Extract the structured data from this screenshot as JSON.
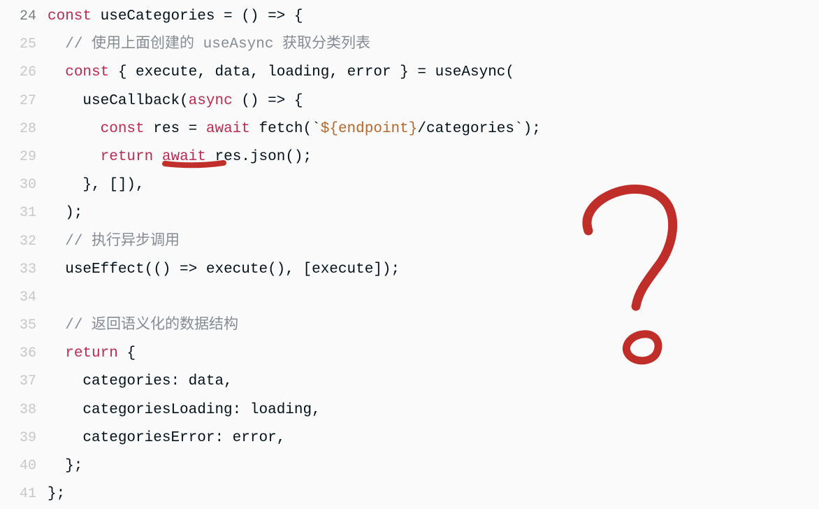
{
  "lines": [
    {
      "no": "24",
      "tokens": [
        [
          "kw",
          "const"
        ],
        [
          "pun",
          " "
        ],
        [
          "id",
          "useCategories"
        ],
        [
          "pun",
          " = () => {"
        ]
      ]
    },
    {
      "no": "25",
      "tokens": [
        [
          "pun",
          "  "
        ],
        [
          "cmt",
          "// 使用上面创建的 useAsync 获取分类列表"
        ]
      ]
    },
    {
      "no": "26",
      "tokens": [
        [
          "pun",
          "  "
        ],
        [
          "kw",
          "const"
        ],
        [
          "pun",
          " { "
        ],
        [
          "id",
          "execute"
        ],
        [
          "pun",
          ", "
        ],
        [
          "id",
          "data"
        ],
        [
          "pun",
          ", "
        ],
        [
          "id",
          "loading"
        ],
        [
          "pun",
          ", "
        ],
        [
          "id",
          "error"
        ],
        [
          "pun",
          " } = "
        ],
        [
          "fn",
          "useAsync"
        ],
        [
          "pun",
          "("
        ]
      ]
    },
    {
      "no": "27",
      "tokens": [
        [
          "pun",
          "    "
        ],
        [
          "fn",
          "useCallback"
        ],
        [
          "pun",
          "("
        ],
        [
          "kw",
          "async"
        ],
        [
          "pun",
          " () => {"
        ]
      ]
    },
    {
      "no": "28",
      "tokens": [
        [
          "pun",
          "      "
        ],
        [
          "kw",
          "const"
        ],
        [
          "pun",
          " "
        ],
        [
          "id",
          "res"
        ],
        [
          "pun",
          " = "
        ],
        [
          "kw",
          "await"
        ],
        [
          "pun",
          " "
        ],
        [
          "fn",
          "fetch"
        ],
        [
          "pun",
          "(`"
        ],
        [
          "inter",
          "${endpoint}"
        ],
        [
          "str",
          "/categories"
        ],
        [
          "pun",
          "`);"
        ]
      ]
    },
    {
      "no": "29",
      "tokens": [
        [
          "pun",
          "      "
        ],
        [
          "kw",
          "return"
        ],
        [
          "pun",
          " "
        ],
        [
          "kw",
          "await"
        ],
        [
          "pun",
          " "
        ],
        [
          "id",
          "res"
        ],
        [
          "pun",
          "."
        ],
        [
          "fn",
          "json"
        ],
        [
          "pun",
          "();"
        ]
      ]
    },
    {
      "no": "30",
      "tokens": [
        [
          "pun",
          "    }, []),"
        ]
      ]
    },
    {
      "no": "31",
      "tokens": [
        [
          "pun",
          "  );"
        ]
      ]
    },
    {
      "no": "32",
      "tokens": [
        [
          "pun",
          "  "
        ],
        [
          "cmt",
          "// 执行异步调用"
        ]
      ]
    },
    {
      "no": "33",
      "tokens": [
        [
          "pun",
          "  "
        ],
        [
          "fn",
          "useEffect"
        ],
        [
          "pun",
          "(() => "
        ],
        [
          "fn",
          "execute"
        ],
        [
          "pun",
          "(), ["
        ],
        [
          "id",
          "execute"
        ],
        [
          "pun",
          "]);"
        ]
      ]
    },
    {
      "no": "34",
      "tokens": []
    },
    {
      "no": "35",
      "tokens": [
        [
          "pun",
          "  "
        ],
        [
          "cmt",
          "// 返回语义化的数据结构"
        ]
      ]
    },
    {
      "no": "36",
      "tokens": [
        [
          "pun",
          "  "
        ],
        [
          "kw",
          "return"
        ],
        [
          "pun",
          " {"
        ]
      ]
    },
    {
      "no": "37",
      "tokens": [
        [
          "pun",
          "    "
        ],
        [
          "id",
          "categories"
        ],
        [
          "pun",
          ": "
        ],
        [
          "id",
          "data"
        ],
        [
          "pun",
          ","
        ]
      ]
    },
    {
      "no": "38",
      "tokens": [
        [
          "pun",
          "    "
        ],
        [
          "id",
          "categoriesLoading"
        ],
        [
          "pun",
          ": "
        ],
        [
          "id",
          "loading"
        ],
        [
          "pun",
          ","
        ]
      ]
    },
    {
      "no": "39",
      "tokens": [
        [
          "pun",
          "    "
        ],
        [
          "id",
          "categoriesError"
        ],
        [
          "pun",
          ": "
        ],
        [
          "id",
          "error"
        ],
        [
          "pun",
          ","
        ]
      ]
    },
    {
      "no": "40",
      "tokens": [
        [
          "pun",
          "  };"
        ]
      ]
    },
    {
      "no": "41",
      "tokens": [
        [
          "pun",
          "};"
        ]
      ]
    }
  ],
  "annotation": {
    "underline_word": "await",
    "symbol": "question-mark"
  }
}
